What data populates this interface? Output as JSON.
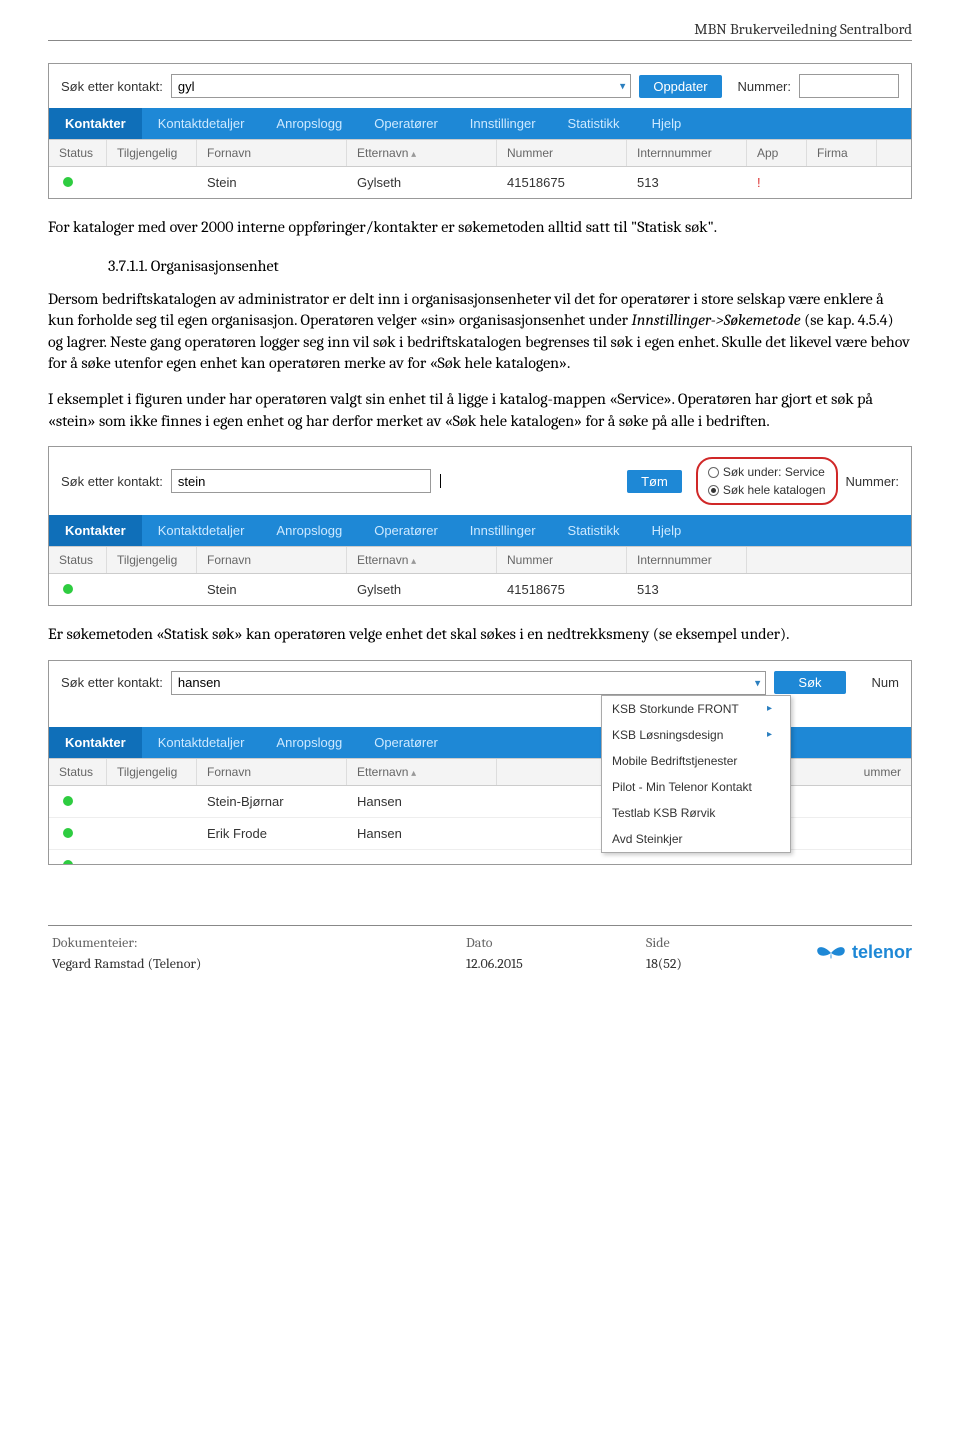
{
  "doc": {
    "title": "MBN Brukerveiledning Sentralbord"
  },
  "fig1": {
    "search_label": "Søk etter kontakt:",
    "search_value": "gyl",
    "update_btn": "Oppdater",
    "nummer_label": "Nummer:",
    "nummer_value": "",
    "tabs": [
      "Kontakter",
      "Kontaktdetaljer",
      "Anropslogg",
      "Operatører",
      "Innstillinger",
      "Statistikk",
      "Hjelp"
    ],
    "cols": {
      "status": "Status",
      "tilgjengelig": "Tilgjengelig",
      "fornavn": "Fornavn",
      "etternavn": "Etternavn",
      "nummer": "Nummer",
      "internnummer": "Internnummer",
      "app": "App",
      "firma": "Firma"
    },
    "row": {
      "fornavn": "Stein",
      "etternavn": "Gylseth",
      "nummer": "41518675",
      "intern": "513",
      "app": "!"
    }
  },
  "body": {
    "p1": "For kataloger med over 2000 interne oppføringer/kontakter er søkemetoden alltid satt til \"Statisk søk\".",
    "sec_num": "3.7.1.1. Organisasjonsenhet",
    "p2a": "Dersom bedriftskatalogen av administrator er delt inn i organisasjonsenheter vil det for operatører i store selskap være enklere å kun forholde seg til egen organisasjon. Operatøren velger «sin» organisasjonsenhet under ",
    "p2b_italic": "Innstillinger->Søkemetode",
    "p2c": " (se kap. 4.5.4) og lagrer.",
    "p2d": "Neste gang operatøren logger seg inn vil søk i bedriftskatalogen begrenses til søk i egen enhet. Skulle det likevel være behov for å søke utenfor egen enhet kan operatøren merke av for «Søk hele katalogen».",
    "p3": "I eksemplet i figuren under har operatøren valgt sin enhet til å ligge i katalog-mappen «Service». Operatøren har gjort et søk på «stein» som ikke finnes i egen enhet og har derfor merket av «Søk hele katalogen» for å søke på alle i bedriften.",
    "p4": "Er søkemetoden «Statisk søk» kan operatøren velge enhet det skal søkes i en nedtrekksmeny (se eksempel under)."
  },
  "fig2": {
    "search_label": "Søk etter kontakt:",
    "search_value": "stein",
    "clear_btn": "Tøm",
    "radio1": "Søk under: Service",
    "radio2": "Søk hele katalogen",
    "nummer_label": "Nummer:",
    "tabs": [
      "Kontakter",
      "Kontaktdetaljer",
      "Anropslogg",
      "Operatører",
      "Innstillinger",
      "Statistikk",
      "Hjelp"
    ],
    "cols": {
      "status": "Status",
      "tilgjengelig": "Tilgjengelig",
      "fornavn": "Fornavn",
      "etternavn": "Etternavn",
      "nummer": "Nummer",
      "internnummer": "Internnummer"
    },
    "row": {
      "fornavn": "Stein",
      "etternavn": "Gylseth",
      "nummer": "41518675",
      "intern": "513"
    }
  },
  "fig3": {
    "search_label": "Søk etter kontakt:",
    "search_value": "hansen",
    "search_btn": "Søk",
    "num_cut": "Num",
    "tabs": [
      "Kontakter",
      "Kontaktdetaljer",
      "Anropslogg",
      "Operatører"
    ],
    "cols": {
      "status": "Status",
      "tilgjengelig": "Tilgjengelig",
      "fornavn": "Fornavn",
      "etternavn": "Etternavn",
      "ummer": "ummer"
    },
    "rows": [
      {
        "fornavn": "Stein-Bjørnar",
        "etternavn": "Hansen"
      },
      {
        "fornavn": "Erik Frode",
        "etternavn": "Hansen"
      }
    ],
    "dropdown": [
      "KSB Storkunde FRONT",
      "KSB Løsningsdesign",
      "Mobile Bedriftstjenester",
      "Pilot - Min Telenor Kontakt",
      "Testlab KSB Rørvik",
      "Avd Steinkjer"
    ]
  },
  "footer": {
    "owner_lbl": "Dokumenteier:",
    "owner": "Vegard Ramstad (Telenor)",
    "date_lbl": "Dato",
    "date": "12.06.2015",
    "page_lbl": "Side",
    "page": "18(52)",
    "logo_text": "telenor"
  }
}
